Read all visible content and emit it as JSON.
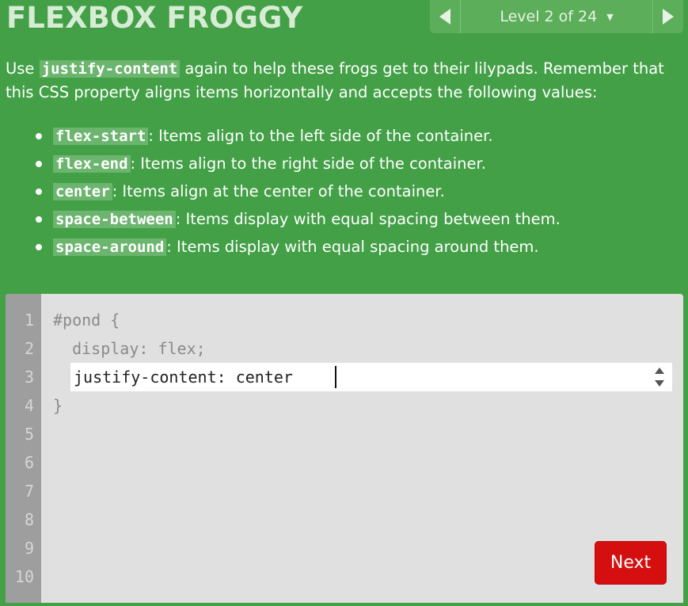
{
  "header": {
    "title": "FLEXBOX FROGGY",
    "level_label": "Level 2 of 24",
    "prev_icon": "triangle-left-icon",
    "next_icon": "triangle-right-icon",
    "dropdown_icon": "caret-down-icon"
  },
  "instructions": {
    "intro_before": "Use ",
    "intro_code": "justify-content",
    "intro_after": " again to help these frogs get to their lilypads. Remember that this CSS property aligns items horizontally and accepts the following values:",
    "values": [
      {
        "code": "flex-start",
        "text": ": Items align to the left side of the container."
      },
      {
        "code": "flex-end",
        "text": ": Items align to the right side of the container."
      },
      {
        "code": "center",
        "text": ": Items align at the center of the container."
      },
      {
        "code": "space-between",
        "text": ": Items display with equal spacing between them."
      },
      {
        "code": "space-around",
        "text": ": Items display with equal spacing around them."
      }
    ]
  },
  "editor": {
    "line_numbers": [
      "1",
      "2",
      "3",
      "4",
      "5",
      "6",
      "7",
      "8",
      "9",
      "10"
    ],
    "line1": "#pond {",
    "line2": "  display: flex;",
    "input_value": "justify-content: center",
    "line4": "}",
    "next_label": "Next"
  },
  "colors": {
    "background": "#43a047",
    "editor_bg": "#e0e0e0",
    "gutter_bg": "#9e9e9e",
    "next_button": "#d50f0f"
  }
}
